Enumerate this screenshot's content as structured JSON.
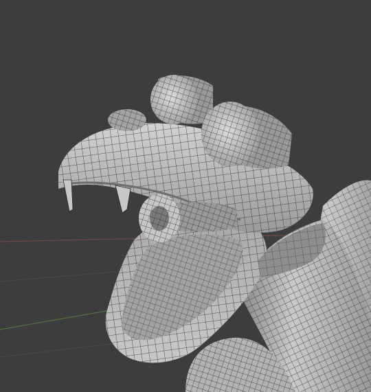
{
  "viewport": {
    "background": "#3d3d3d",
    "grid_line_color": "#4a4a4a",
    "axis_x_color": "#7a4a4a",
    "axis_y_color": "#5a7a3a"
  },
  "model": {
    "description_name": "snake-head-wireframe",
    "surface_color": "#b9b9b9",
    "highlight_color": "#d6d6d6",
    "shadow_color": "#6e6e6e",
    "wire_color": "#2a2a2a",
    "mouth_interior_color": "#9c9c9c"
  }
}
